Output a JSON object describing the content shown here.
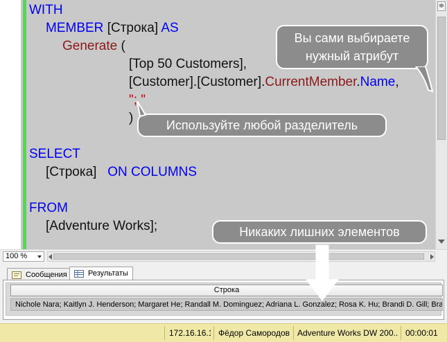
{
  "editor": {
    "lines": [
      {
        "parts": [
          {
            "t": "WITH",
            "c": "kw"
          }
        ]
      },
      {
        "parts": [
          {
            "t": "MEMBER ",
            "c": "kw"
          },
          {
            "t": "[Строка] ",
            "c": "tx"
          },
          {
            "t": "AS",
            "c": "kw"
          }
        ]
      },
      {
        "parts": [
          {
            "t": "Generate",
            "c": "fn"
          },
          {
            "t": " (",
            "c": "tx"
          }
        ]
      },
      {
        "parts": [
          {
            "t": "[Top 50 Customers],",
            "c": "tx"
          }
        ]
      },
      {
        "parts": [
          {
            "t": "[Customer].[Customer].",
            "c": "tx"
          },
          {
            "t": "CurrentMember",
            "c": "fn"
          },
          {
            "t": ".",
            "c": "tx"
          },
          {
            "t": "Name",
            "c": "prop"
          },
          {
            "t": ",",
            "c": "tx"
          }
        ]
      },
      {
        "parts": [
          {
            "t": "\"; \"",
            "c": "str"
          }
        ]
      },
      {
        "parts": [
          {
            "t": ")",
            "c": "tx"
          }
        ]
      },
      {
        "parts": []
      },
      {
        "parts": [
          {
            "t": "SELECT",
            "c": "kw"
          }
        ]
      },
      {
        "parts": [
          {
            "t": "[Строка]",
            "c": "tx"
          },
          {
            "t": "   ON COLUMNS",
            "c": "kw"
          }
        ]
      },
      {
        "parts": []
      },
      {
        "parts": [
          {
            "t": "FROM",
            "c": "kw"
          }
        ]
      },
      {
        "parts": [
          {
            "t": "[Adventure Works];",
            "c": "tx"
          }
        ]
      }
    ]
  },
  "callouts": {
    "attribute": "Вы сами выбираете нужный атрибут",
    "separator": "Используйте любой разделитель",
    "no_extra": "Никаких лишних элементов"
  },
  "zoom": {
    "value": "100 %"
  },
  "results": {
    "tabs": [
      {
        "label": "Сообщения",
        "active": false
      },
      {
        "label": "Результаты",
        "active": true
      }
    ],
    "column_header": "Строка",
    "row_value": "Nichole Nara; Kaitlyn J. Henderson; Margaret He; Randall M. Dominguez; Adriana L. Gonzalez; Rosa K. Hu; Brandi D. Gill; Brad..."
  },
  "status": {
    "server": "172.16.16.1",
    "user": "Фёдор Самородов",
    "database": "Adventure Works DW 200...",
    "elapsed": "00:00:01"
  }
}
